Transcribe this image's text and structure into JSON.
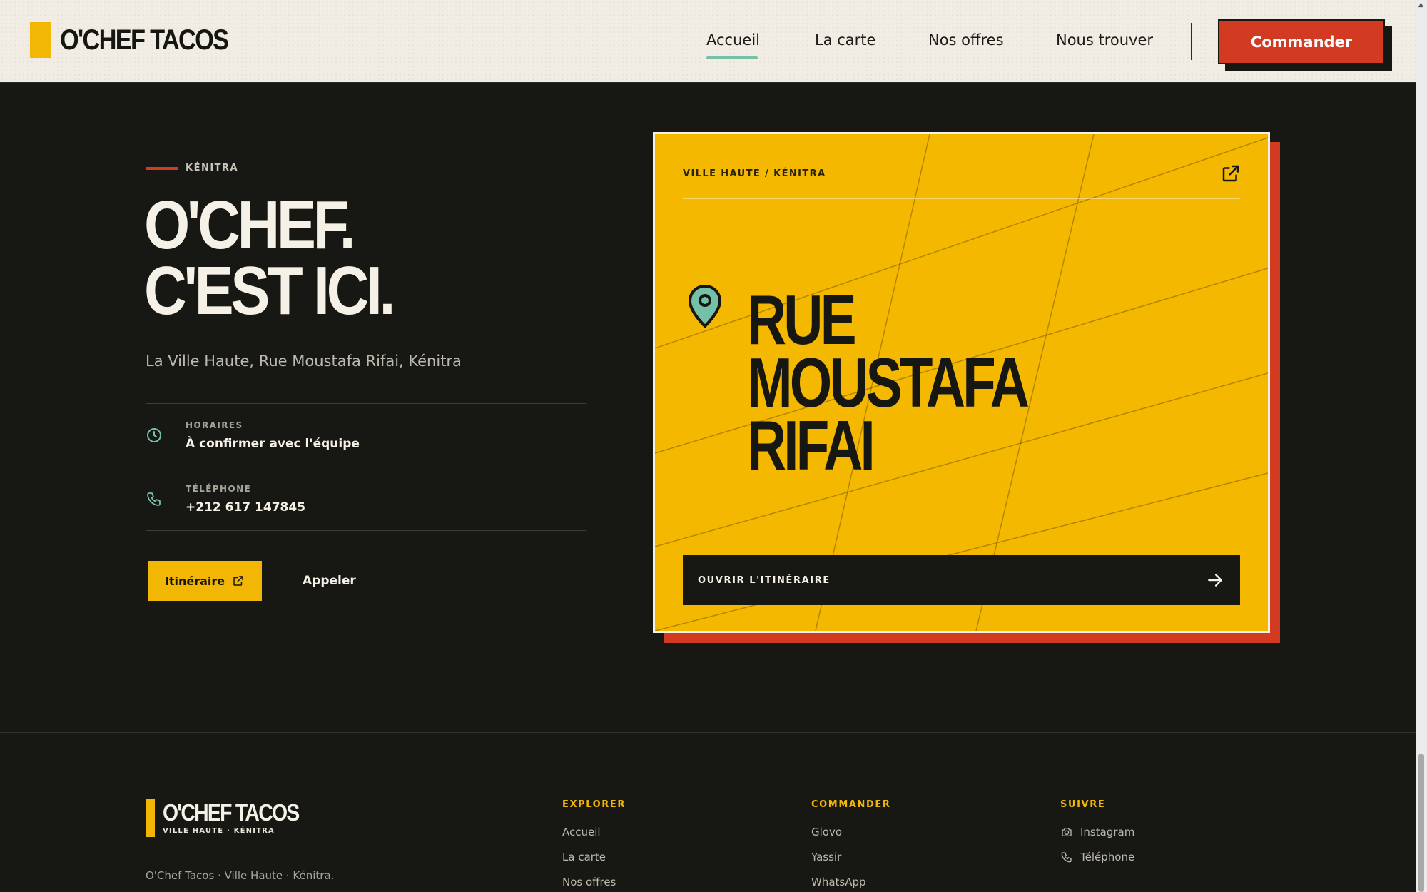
{
  "brand": {
    "name": "O'CHEF TACOS",
    "tagline": "VILLE HAUTE · KÉNITRA"
  },
  "colors": {
    "yellow": "#f2b705",
    "red": "#d33a22",
    "mint": "#76c0a8",
    "dark": "#171714",
    "cream": "#f1ede4"
  },
  "nav": {
    "items": [
      {
        "label": "Accueil",
        "active": true
      },
      {
        "label": "La carte",
        "active": false
      },
      {
        "label": "Nos offres",
        "active": false
      },
      {
        "label": "Nous trouver",
        "active": false
      }
    ],
    "cta": "Commander"
  },
  "location": {
    "eyebrow": "KÉNITRA",
    "headline_1": "O'CHEF.",
    "headline_2": "C'EST ICI.",
    "address": "La Ville Haute, Rue Moustafa Rifai, Kénitra",
    "hours_label": "HORAIRES",
    "hours_value": "À confirmer avec l'équipe",
    "phone_label": "TÉLÉPHONE",
    "phone_value": "+212 617 147845",
    "itinerary_button": "Itinéraire",
    "call_button": "Appeler"
  },
  "card": {
    "tag": "VILLE HAUTE / KÉNITRA",
    "street_1": "RUE",
    "street_2": "MOUSTAFA",
    "street_3": "RIFAI",
    "button": "OUVRIR L'ITINÉRAIRE",
    "icons": {
      "external": "external-link-icon",
      "pin": "map-pin-icon",
      "arrow": "arrow-right-icon"
    }
  },
  "footer": {
    "copy": "O'Chef Tacos · Ville Haute · Kénitra.",
    "columns": [
      {
        "title": "EXPLORER",
        "links": [
          "Accueil",
          "La carte",
          "Nos offres"
        ]
      },
      {
        "title": "COMMANDER",
        "links": [
          "Glovo",
          "Yassir",
          "WhatsApp"
        ]
      },
      {
        "title": "SUIVRE",
        "links": [
          "Instagram",
          "Téléphone"
        ]
      }
    ]
  }
}
